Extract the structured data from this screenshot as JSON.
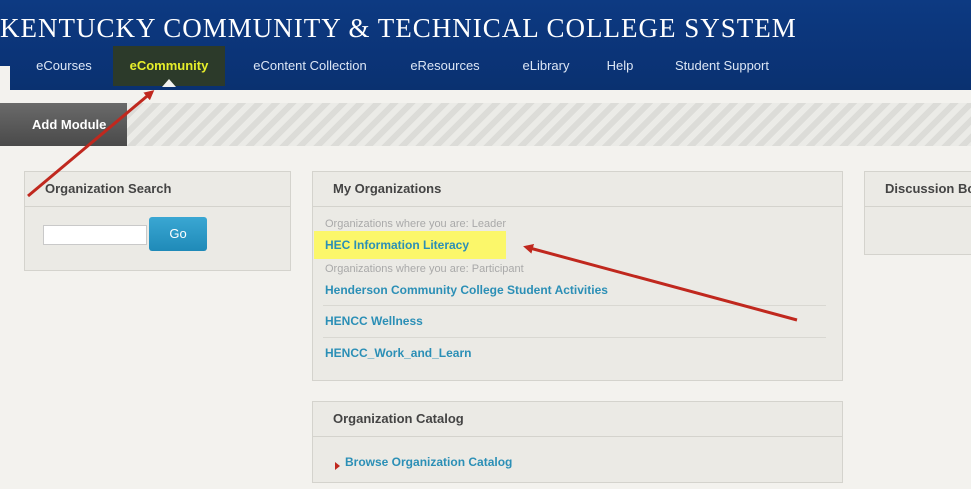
{
  "banner": {
    "title": "KENTUCKY COMMUNITY & TECHNICAL COLLEGE SYSTEM"
  },
  "nav": {
    "items": [
      "eCourses",
      "eCommunity",
      "eContent Collection",
      "eResources",
      "eLibrary",
      "Help",
      "Student Support"
    ],
    "active": "eCommunity"
  },
  "toolbar": {
    "add_module": "Add Module"
  },
  "org_search": {
    "title": "Organization Search",
    "input_value": "",
    "go_label": "Go"
  },
  "my_orgs": {
    "title": "My Organizations",
    "leader_caption": "Organizations where you are: Leader",
    "leader_orgs": [
      "HEC Information Literacy"
    ],
    "participant_caption": "Organizations where you are: Participant",
    "participant_orgs": [
      "Henderson Community College Student Activities",
      "HENCC Wellness",
      "HENCC_Work_and_Learn"
    ]
  },
  "catalog": {
    "title": "Organization Catalog",
    "link": "Browse Organization Catalog"
  },
  "discussion": {
    "title": "Discussion Bo"
  },
  "colors": {
    "banner": "#0b3478",
    "active_nav_text": "#e7ef2a",
    "link": "#2b8fb6",
    "highlight": "#fbf76a",
    "arrow": "#c0281e"
  }
}
